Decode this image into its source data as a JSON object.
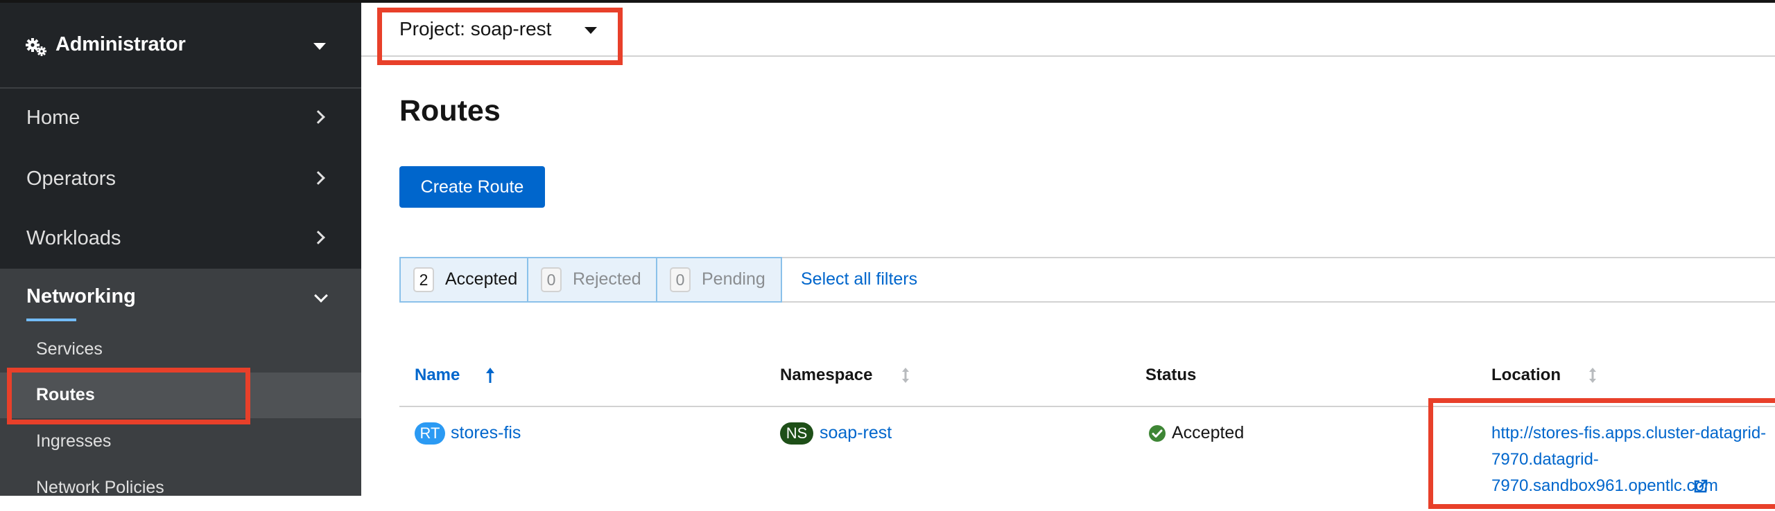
{
  "sidebar": {
    "perspective": "Administrator",
    "items": [
      {
        "label": "Home"
      },
      {
        "label": "Operators"
      },
      {
        "label": "Workloads"
      }
    ],
    "section": {
      "label": "Networking",
      "items": [
        {
          "label": "Services"
        },
        {
          "label": "Routes"
        },
        {
          "label": "Ingresses"
        },
        {
          "label": "Network Policies"
        }
      ]
    }
  },
  "header": {
    "project_label": "Project: soap-rest"
  },
  "main": {
    "title": "Routes",
    "create_button": "Create Route",
    "filters": [
      {
        "count": "2",
        "label": "Accepted"
      },
      {
        "count": "0",
        "label": "Rejected"
      },
      {
        "count": "0",
        "label": "Pending"
      }
    ],
    "select_all": "Select all filters"
  },
  "table": {
    "columns": [
      "Name",
      "Namespace",
      "Status",
      "Location"
    ],
    "rows": [
      {
        "name_badge": "RT",
        "name": "stores-fis",
        "ns_badge": "NS",
        "namespace": "soap-rest",
        "status": "Accepted",
        "location_lines": [
          "http://stores-fis.apps.cluster-datagrid-",
          "7970.datagrid-",
          "7970.sandbox961.opentlc.com"
        ]
      }
    ]
  },
  "colors": {
    "sidebar_bg": "#212427",
    "section_bg": "#3c3f42",
    "active_item_bg": "#4f5255",
    "accent": "#0066cc",
    "highlight": "#e8402a",
    "route_badge": "#2b9af3",
    "ns_badge": "#1e4f18",
    "success": "#3e8635"
  }
}
